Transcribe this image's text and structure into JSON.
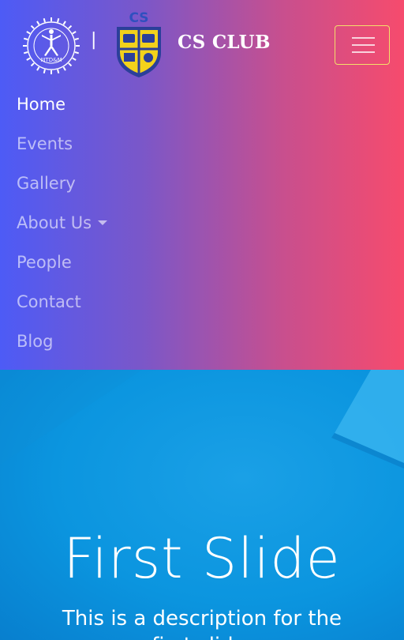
{
  "brand": {
    "institute_logo_text": "IIITD&M",
    "club_logo_text": "CS",
    "separator": "|",
    "club_name": "CS CLUB"
  },
  "navbar": {
    "toggler_icon": "hamburger-icon",
    "items": [
      {
        "label": "Home",
        "active": true
      },
      {
        "label": "Events"
      },
      {
        "label": "Gallery"
      },
      {
        "label": "About Us",
        "dropdown": true
      },
      {
        "label": "People"
      },
      {
        "label": "Contact"
      },
      {
        "label": "Blog"
      }
    ]
  },
  "carousel": {
    "title": "First Slide",
    "description": "This is a description for the first slide."
  },
  "colors": {
    "header_gradient_start": "#4d5bf6",
    "header_gradient_end": "#f64b6d",
    "slide_bg": "#0b95df",
    "toggler_border": "#f3e06a"
  }
}
